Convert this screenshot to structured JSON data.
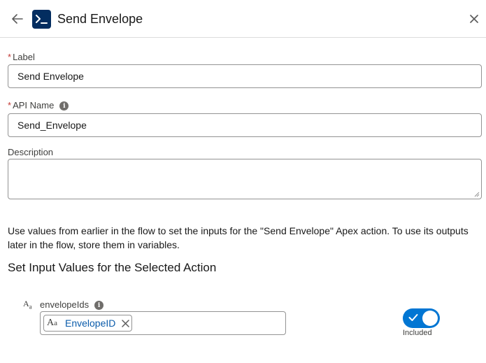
{
  "header": {
    "title": "Send Envelope",
    "back_icon": "arrow-left-icon",
    "app_icon": "apex-terminal-icon",
    "close_icon": "close-icon"
  },
  "fields": {
    "required_marker": "*",
    "label": {
      "label": "Label",
      "value": "Send Envelope"
    },
    "api_name": {
      "label": "API Name",
      "value": "Send_Envelope",
      "info_icon": "info-icon"
    },
    "description": {
      "label": "Description",
      "value": ""
    }
  },
  "help_text": "Use values from earlier in the flow to set the inputs for the \"Send Envelope\" Apex action. To use its outputs later in the flow, store them in variables.",
  "section_title": "Set Input Values for the Selected Action",
  "parameters": [
    {
      "type_icon": "text-type-icon",
      "type_glyph": "Aa",
      "name": "envelopeIds",
      "value_pill": "EnvelopeID",
      "included": true,
      "included_label": "Included"
    }
  ],
  "colors": {
    "brand_dark": "#032d60",
    "accent": "#0176d3",
    "required": "#c23934",
    "link": "#0b5cab"
  }
}
